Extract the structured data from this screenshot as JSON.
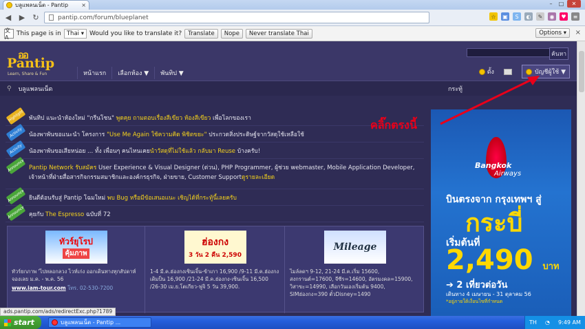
{
  "browser": {
    "tab_title": "บลูแพลนเน็ต - Pantip",
    "tab_close": "×",
    "url": "pantip.com/forum/blueplanet",
    "win_min": "–",
    "win_max": "□",
    "win_close": "✕",
    "back": "◀",
    "forward": "▶",
    "reload": "↻",
    "star": "☆"
  },
  "translate": {
    "prefix": "This page is in",
    "language": "Thai",
    "question": "Would you like to translate it?",
    "translate_btn": "Translate",
    "nope_btn": "Nope",
    "never_btn": "Never translate Thai",
    "options_btn": "Options",
    "close": "×"
  },
  "header": {
    "logo_name": "Pantip",
    "logo_slogan": "Learn, Share & Fun",
    "search_btn": "ค้นหา",
    "menu": [
      "หน้าแรก",
      "เลือกห้อง ▼",
      "พันทิป ▼"
    ],
    "like_label": "ตั้ง",
    "account_label": "บัญชีผู้ใช้ ▼"
  },
  "subbar": {
    "breadcrumb": "บลูแพลนเน็ต",
    "right": "กระทู้"
  },
  "announcements": [
    {
      "tag": "Highlight",
      "color": "#e8b21e",
      "pre": "พันทิป แนะนำห้องใหม่ \"กรีนโซน\" ",
      "hl": "พูดคุย ถามตอบเรื่องสีเขียว ห้องสีเขียว",
      "post": " เพื่อโลกของเรา"
    },
    {
      "tag": "Activity",
      "color": "#2f7fd4",
      "pre": "น้องพาพันขอแนะนำ โครงการ ",
      "hl": "\"Use Me Again ใช้ความคิด พิชิตขยะ\"",
      "post": " ประกวดสิ่งประดิษฐ์จากวัสดุใช้เหลือใช้"
    },
    {
      "tag": "Activity",
      "color": "#2f7fd4",
      "pre": "น้องพาพันขอเสียหน่อย ... ทั้ง เพื่อนๆ คนไหนเคย",
      "hl": "นำวัสดุที่ไม่ใช้แล้ว กลับมา Reuse",
      "post": " บ้างครับ!"
    },
    {
      "tag": "Announce",
      "color": "#4aa63a",
      "pre": "",
      "hl": "Pantip Network รับสมัคร",
      "post": " User Experience & Visual Designer (ด่วน), PHP Programmer, ผู้ช่วย webmaster, Mobile Application Developer, เจ้าหน้าที่ฝ่ายสื่อสารกิจกรรมสมาชิกและองค์กรธุรกิจ, ฝ่ายขาย, Customer Support",
      "hl2": "ดูรายละเอียด"
    },
    {
      "tag": "Announce",
      "color": "#4aa63a",
      "pre": "ยินดีต้อนรับสู่ Pantip โฉมใหม่ ",
      "hl": "พบ Bug หรือมีข้อเสนอแนะ เชิญได้ที่กระทู้นี้เลยครับ",
      "post": ""
    },
    {
      "tag": "Announce",
      "color": "#4aa63a",
      "pre": "คุยกับ ",
      "hl": "The Espresso",
      "post": " ฉบับที่ 72"
    }
  ],
  "ads": [
    {
      "img_title": "ทัวร์ยุโรป",
      "img_sub": "คุ้มภาพ",
      "text": "ทัวร์ยกภาพ 'ไปหลอกลวง ไวท์เก่ง ออกเดินทางทุกสัปดาห์ จองเลย ม.ค. - พ.ค. 56",
      "link": "www.iam-tour.com",
      "phone": "โทร. 02-530-7200"
    },
    {
      "img_title": "ฮ่องกง",
      "img_sub": "3 วัน 2 คืน 2,590",
      "text": "1-4 มี.ค.ฮ่องกงเซินเจิ้น-ข้าเกา 16,900 /9-11 มี.ค.ฮ่องกงเดิมป็น 16,900 /21-24 มี.ค.ฮ่องกง-เซินเจิ้น 16,500 /26-30 เม.ย.โตเกียว-ฟูจิ 5 วัน 39,900."
    },
    {
      "img_title": "Mileage",
      "img_sub": "",
      "text": "ไมล์ลดฯ 9-12, 21-24 มี.ค.เริ่ม 15600, สงกรานต์=17600, จีซีร=14600, อัตรมงคล=15900, วิสาขะ=14990, เลือกวันเองเริ่มต้น 9400, SIMฮ่องกง=390 ตั๋วDisney=1490"
    }
  ],
  "banner": {
    "brand1": "Bangkok",
    "brand2": "Airways",
    "line1": "บินตรงจาก กรุงเทพฯ สู่",
    "dest": "กระบี่",
    "line2": "เริ่มต้นที่",
    "price": "2,490",
    "unit": "บาท",
    "freq": "➔ 2 เที่ยวต่อวัน",
    "period": "เดินทาง 4 เมษายน - 31 ตุลาคม 56",
    "note": "*อยู่ภายใต้เงื่อนไขที่กำหนด"
  },
  "annotation": "คลิ๊กตรงนี้",
  "status_url": "ads.pantip.com/ads/redirectExc.php?1789",
  "taskbar": {
    "start": "start",
    "task": "บลูแพลนเน็ต - Pantip ...",
    "lang": "TH",
    "time": "9:49 AM"
  },
  "colors": {
    "accent": "#f5c018",
    "bg": "#2f2c55",
    "annot": "#e8001a"
  }
}
